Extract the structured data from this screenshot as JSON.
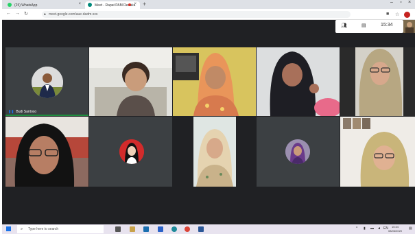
{
  "browser": {
    "tabs": [
      {
        "title": "(25) WhatsApp",
        "icon": "whatsapp-icon",
        "color": "#25d366"
      },
      {
        "title": "Meet - Rapat PAM Renuka",
        "icon": "meet-icon",
        "color": "#00897b"
      }
    ],
    "address": "meet.google.com/aue-dadm-sxs"
  },
  "meet": {
    "time": "15:34",
    "participants": [
      {
        "name": "Budi Santoso",
        "view": "avatar"
      },
      {
        "name": "",
        "view": "camera"
      },
      {
        "name": "",
        "view": "camera"
      },
      {
        "name": "",
        "view": "camera"
      },
      {
        "name": "",
        "view": "camera"
      },
      {
        "name": "",
        "view": "camera"
      },
      {
        "name": "",
        "view": "avatar"
      },
      {
        "name": "",
        "view": "camera"
      },
      {
        "name": "",
        "view": "avatar"
      },
      {
        "name": "",
        "view": "camera"
      }
    ]
  },
  "taskbar": {
    "search_placeholder": "Type here to search",
    "clock_time": "15:34",
    "clock_date": "08/06/2020"
  }
}
